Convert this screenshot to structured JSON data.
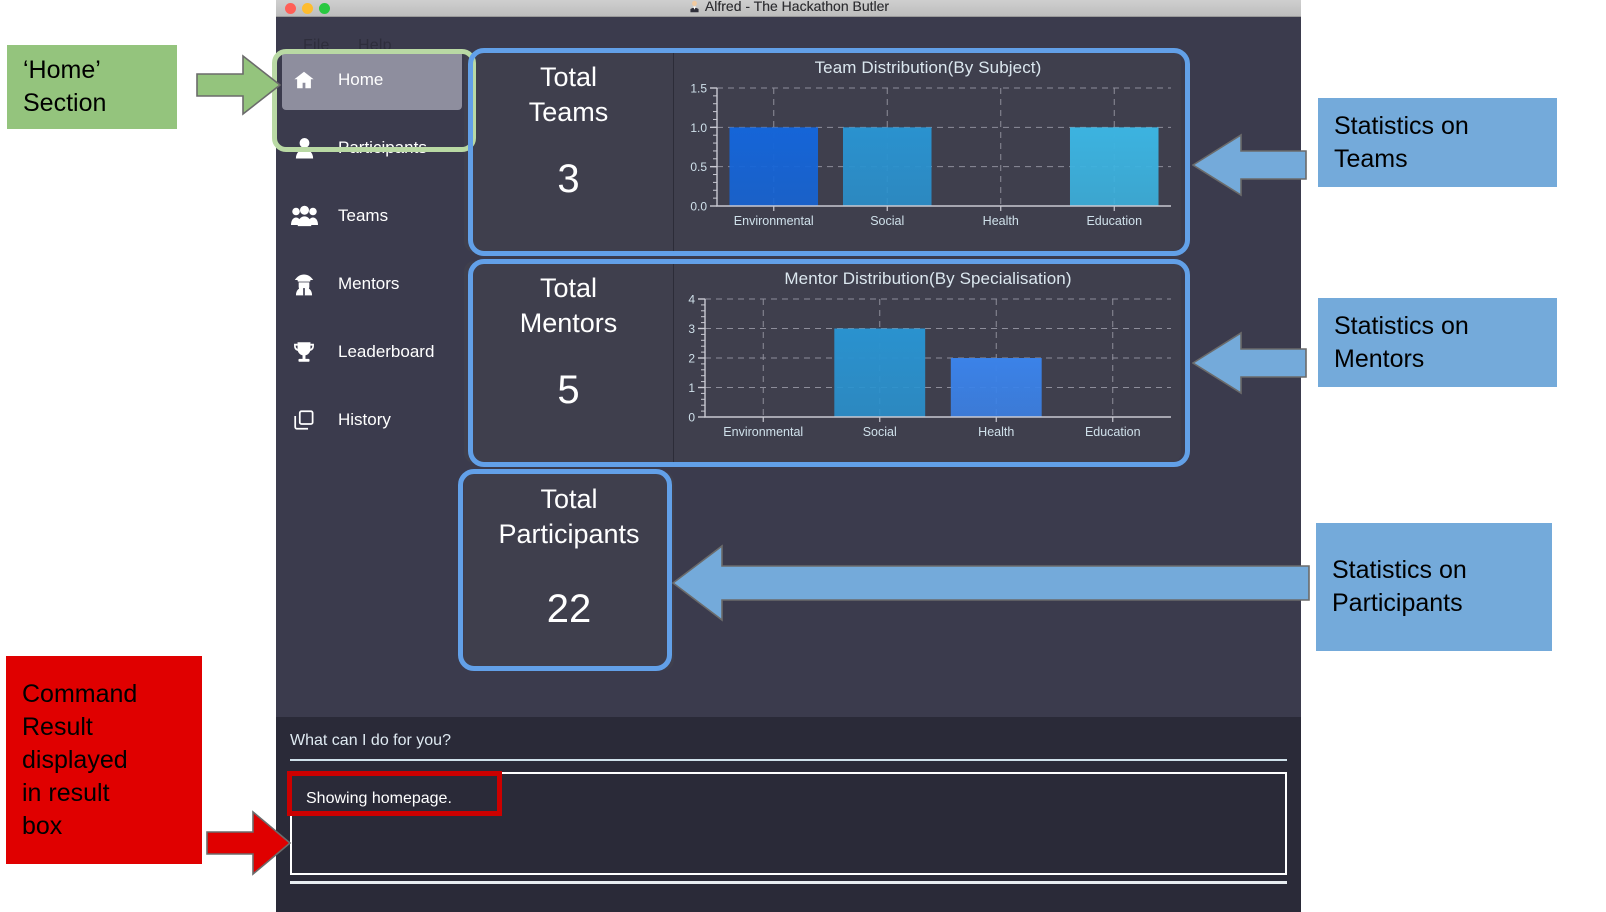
{
  "window": {
    "title": "Alfred - The Hackathon Butler",
    "traffic_lights": [
      "close-red",
      "minimize-yellow",
      "maximize-green"
    ]
  },
  "menubar": {
    "items": [
      {
        "label": "File"
      },
      {
        "label": "Help"
      }
    ]
  },
  "sidebar": {
    "items": [
      {
        "label": "Home",
        "icon": "home-icon",
        "active": true
      },
      {
        "label": "Participants",
        "icon": "user-icon",
        "active": false
      },
      {
        "label": "Teams",
        "icon": "users-icon",
        "active": false
      },
      {
        "label": "Mentors",
        "icon": "user-secret-icon",
        "active": false
      },
      {
        "label": "Leaderboard",
        "icon": "trophy-icon",
        "active": false
      },
      {
        "label": "History",
        "icon": "copy-icon",
        "active": false
      }
    ]
  },
  "stats": {
    "teams": {
      "title": "Total\nTeams",
      "title_l1": "Total",
      "title_l2": "Teams",
      "value": "3"
    },
    "mentors": {
      "title": "Total\nMentors",
      "title_l1": "Total",
      "title_l2": "Mentors",
      "value": "5"
    },
    "participants": {
      "title": "Total\nParticipants",
      "title_l1": "Total",
      "title_l2": "Participants",
      "value": "22"
    }
  },
  "command": {
    "prompt_label": "What can I do for you?",
    "input_value": "",
    "result_text": "Showing homepage."
  },
  "annotations": {
    "home_section": {
      "line1": "‘Home’",
      "line2": "Section",
      "color": "#94c47d",
      "arrow": "right"
    },
    "stats_teams": {
      "line1": "Statistics on",
      "line2": "Teams",
      "color": "#74aada",
      "arrow": "left"
    },
    "stats_mentors": {
      "line1": "Statistics on",
      "line2": "Mentors",
      "color": "#74aada",
      "arrow": "left"
    },
    "stats_parts": {
      "line1": "Statistics on",
      "line2": "Participants",
      "color": "#74aada",
      "arrow": "left"
    },
    "command_result": {
      "line1": "Command",
      "line2": "Result",
      "line3": "displayed",
      "line4": "in result",
      "line5": "box",
      "color": "#e00000",
      "arrow": "right"
    }
  },
  "colors": {
    "app_bg": "#3b3b4d",
    "card_bg": "#3f3f4d",
    "cmd_bg": "#2a2a38",
    "accent_highlight_blue": "#62a0e8",
    "accent_highlight_green": "#b9d9a4",
    "accent_highlight_red": "#cc0000",
    "nav_active": "#8e8e9e",
    "text_primary": "#ffffff",
    "chart_title": "#dbe7ef",
    "tick_text": "#cfe0ea",
    "grid": "#8d8d9a"
  },
  "chart_data": [
    {
      "id": "team-distribution",
      "type": "bar",
      "title": "Team Distribution(By Subject)",
      "categories": [
        "Environmental",
        "Social",
        "Health",
        "Education"
      ],
      "values": [
        1,
        1,
        0,
        1
      ],
      "bar_colors": [
        "#1565d8",
        "#2a92cf",
        "#3cb3e0",
        "#3cb3e0"
      ],
      "xlabel": "",
      "ylabel": "",
      "ylim": [
        0.0,
        1.5
      ],
      "yticks": [
        "0.0",
        "0.5",
        "1.0",
        "1.5"
      ],
      "ytick_values": [
        0.0,
        0.5,
        1.0,
        1.5
      ],
      "grid": true,
      "legend": false
    },
    {
      "id": "mentor-distribution",
      "type": "bar",
      "title": "Mentor Distribution(By Specialisation)",
      "categories": [
        "Environmental",
        "Social",
        "Health",
        "Education"
      ],
      "values": [
        0,
        3,
        2,
        0
      ],
      "bar_colors": [
        "#2a92cf",
        "#2a92cf",
        "#3b82e8",
        "#2a92cf"
      ],
      "xlabel": "",
      "ylabel": "",
      "ylim": [
        0,
        4
      ],
      "yticks": [
        "0",
        "1",
        "2",
        "3",
        "4"
      ],
      "ytick_values": [
        0,
        1,
        2,
        3,
        4
      ],
      "grid": true,
      "legend": false
    }
  ]
}
